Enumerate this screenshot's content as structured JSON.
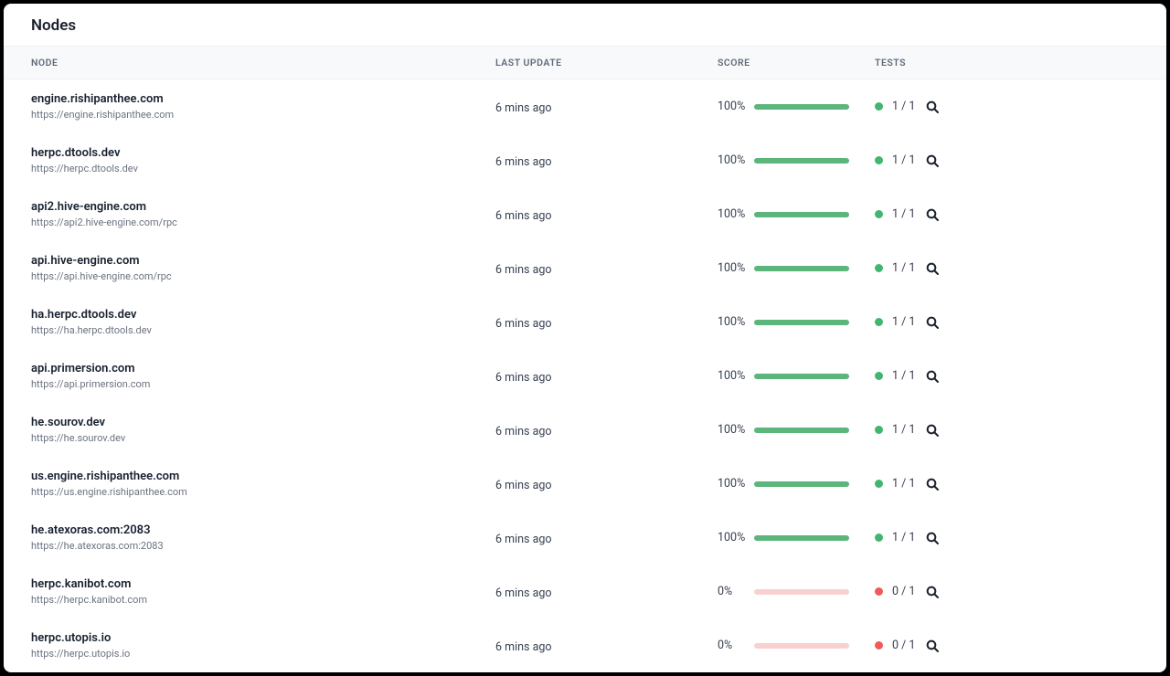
{
  "page_title": "Nodes",
  "columns": {
    "node": "NODE",
    "last_update": "LAST UPDATE",
    "score": "SCORE",
    "tests": "TESTS"
  },
  "rows": [
    {
      "name": "engine.rishipanthee.com",
      "url": "https://engine.rishipanthee.com",
      "last_update": "6 mins ago",
      "score": "100%",
      "tests": "1 / 1",
      "status": "ok"
    },
    {
      "name": "herpc.dtools.dev",
      "url": "https://herpc.dtools.dev",
      "last_update": "6 mins ago",
      "score": "100%",
      "tests": "1 / 1",
      "status": "ok"
    },
    {
      "name": "api2.hive-engine.com",
      "url": "https://api2.hive-engine.com/rpc",
      "last_update": "6 mins ago",
      "score": "100%",
      "tests": "1 / 1",
      "status": "ok"
    },
    {
      "name": "api.hive-engine.com",
      "url": "https://api.hive-engine.com/rpc",
      "last_update": "6 mins ago",
      "score": "100%",
      "tests": "1 / 1",
      "status": "ok"
    },
    {
      "name": "ha.herpc.dtools.dev",
      "url": "https://ha.herpc.dtools.dev",
      "last_update": "6 mins ago",
      "score": "100%",
      "tests": "1 / 1",
      "status": "ok"
    },
    {
      "name": "api.primersion.com",
      "url": "https://api.primersion.com",
      "last_update": "6 mins ago",
      "score": "100%",
      "tests": "1 / 1",
      "status": "ok"
    },
    {
      "name": "he.sourov.dev",
      "url": "https://he.sourov.dev",
      "last_update": "6 mins ago",
      "score": "100%",
      "tests": "1 / 1",
      "status": "ok"
    },
    {
      "name": "us.engine.rishipanthee.com",
      "url": "https://us.engine.rishipanthee.com",
      "last_update": "6 mins ago",
      "score": "100%",
      "tests": "1 / 1",
      "status": "ok"
    },
    {
      "name": "he.atexoras.com:2083",
      "url": "https://he.atexoras.com:2083",
      "last_update": "6 mins ago",
      "score": "100%",
      "tests": "1 / 1",
      "status": "ok"
    },
    {
      "name": "herpc.kanibot.com",
      "url": "https://herpc.kanibot.com",
      "last_update": "6 mins ago",
      "score": "0%",
      "tests": "0 / 1",
      "status": "fail"
    },
    {
      "name": "herpc.utopis.io",
      "url": "https://herpc.utopis.io",
      "last_update": "6 mins ago",
      "score": "0%",
      "tests": "0 / 1",
      "status": "fail"
    }
  ]
}
